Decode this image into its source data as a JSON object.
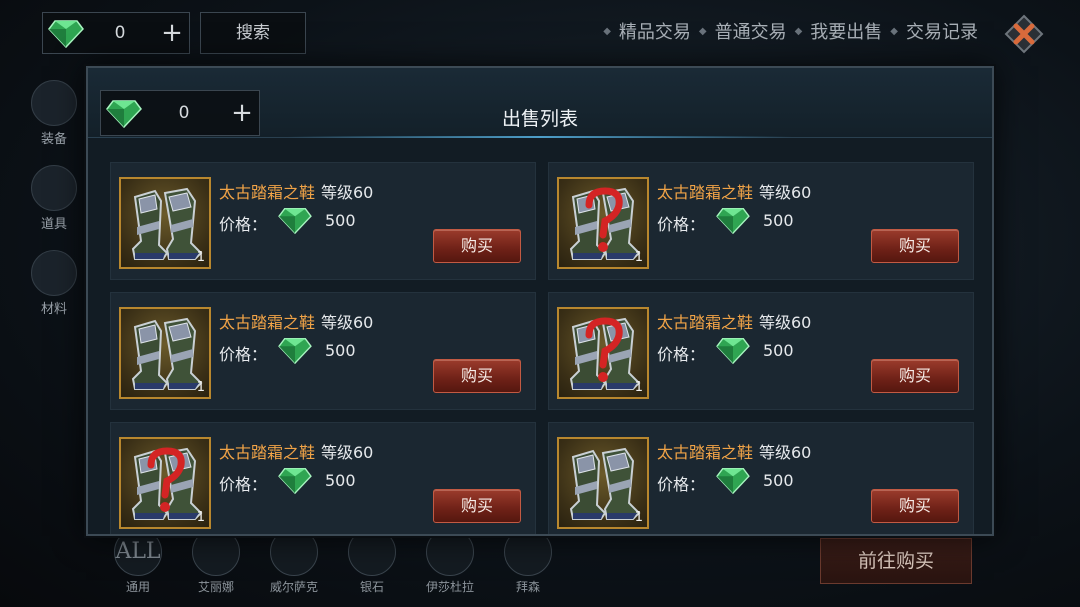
{
  "top": {
    "gem_count": "0",
    "plus": "+",
    "search_label": "搜索",
    "nav_tabs": [
      "精品交易",
      "普通交易",
      "我要出售",
      "交易记录"
    ]
  },
  "side": {
    "items": [
      "装备",
      "道具",
      "材料"
    ]
  },
  "bottom": {
    "categories": [
      {
        "icon_text": "ALL",
        "label": "通用"
      },
      {
        "icon_text": "",
        "label": "艾丽娜"
      },
      {
        "icon_text": "",
        "label": "威尔萨克"
      },
      {
        "icon_text": "",
        "label": "银石"
      },
      {
        "icon_text": "",
        "label": "伊莎杜拉"
      },
      {
        "icon_text": "",
        "label": "拜森"
      }
    ],
    "goto_label": "前往购买"
  },
  "modal": {
    "title": "出售列表",
    "gem_count": "0",
    "plus": "+",
    "price_label": "价格：",
    "buy_label": "购买",
    "items": [
      {
        "name": "太古踏霜之鞋",
        "level": "等级60",
        "price": "500",
        "qty": "1",
        "variant": "normal"
      },
      {
        "name": "太古踏霜之鞋",
        "level": "等级60",
        "price": "500",
        "qty": "1",
        "variant": "unknown"
      },
      {
        "name": "太古踏霜之鞋",
        "level": "等级60",
        "price": "500",
        "qty": "1",
        "variant": "normal"
      },
      {
        "name": "太古踏霜之鞋",
        "level": "等级60",
        "price": "500",
        "qty": "1",
        "variant": "unknown"
      },
      {
        "name": "太古踏霜之鞋",
        "level": "等级60",
        "price": "500",
        "qty": "1",
        "variant": "unknown"
      },
      {
        "name": "太古踏霜之鞋",
        "level": "等级60",
        "price": "500",
        "qty": "1",
        "variant": "normal"
      }
    ]
  },
  "colors": {
    "item_name": "#f0a347",
    "buy_button": "#8a2d20",
    "gem": "#3fcf6a",
    "frame_gold": "#b8872e"
  },
  "icons": {
    "gem": "green-diamond-icon",
    "boots": "boots-item-icon",
    "unknown": "question-mark-icon",
    "close": "close-x-icon"
  }
}
